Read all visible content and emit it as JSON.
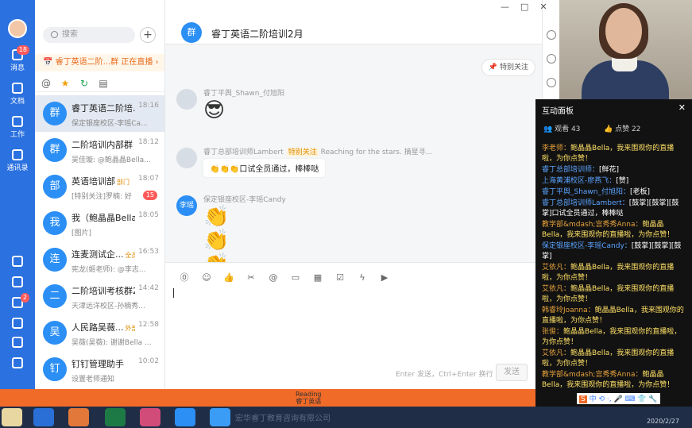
{
  "window": {
    "controls": [
      "—",
      "□",
      "✕"
    ]
  },
  "rail": {
    "items": [
      {
        "label": "消息",
        "icon": "message-icon",
        "badge": "18"
      },
      {
        "label": "文档",
        "icon": "document-icon"
      },
      {
        "label": "工作",
        "icon": "grid-icon"
      },
      {
        "label": "通讯录",
        "icon": "contacts-icon"
      }
    ],
    "lower_badge": "2"
  },
  "sidebar": {
    "search_placeholder": "搜索",
    "live_text": "睿丁英语二阶...群 正在直播",
    "conversations": [
      {
        "name": "睿丁英语二阶培...",
        "preview": "保定银座校区-李瑶Ca...",
        "time": "18:16",
        "avatar": "群"
      },
      {
        "name": "二阶培训内部群",
        "preview": "吴佳璇: @鲍晶晶Bella...",
        "time": "18:12",
        "avatar": "群"
      },
      {
        "name": "英语培训部",
        "tag": "部门",
        "preview": "[特别关注]罗楠: 好",
        "time": "18:07",
        "count": "15",
        "avatar": "部"
      },
      {
        "name": "我（鲍晶晶Bella...",
        "preview": "[图片]",
        "time": "18:05",
        "avatar": "我"
      },
      {
        "name": "连麦测试企...",
        "tag": "全员",
        "preview": "宪龙(姬老师): @李志...",
        "time": "16:53",
        "avatar": "连"
      },
      {
        "name": "二阶培训考核群2",
        "preview": "天津远洋校区-孙楠秀...",
        "time": "14:42",
        "avatar": "二"
      },
      {
        "name": "人民路吴薇...",
        "tag": "外部",
        "preview": "吴薇(吴薇): 谢谢Bella ...",
        "time": "12:58",
        "avatar": "吴"
      },
      {
        "name": "钉钉管理助手",
        "preview": "设置老师通知",
        "time": "10:02",
        "avatar": "钉"
      }
    ]
  },
  "chat": {
    "title": "睿丁英语二阶培训2月",
    "follow_label": "特别关注",
    "messages": [
      {
        "sender": "睿丁平舆_Shawn_付旭阳",
        "content": "😎"
      },
      {
        "sender": "睿丁总部培训师Lambert",
        "tag": "特别关注",
        "signature": "Reaching for the stars. 摘星寻...",
        "content": "👏👏👏口试全员通过，棒棒哒"
      },
      {
        "sender": "保定银座校区-李瑶Candy",
        "avatar": "李瑶",
        "content": "👏👏👏"
      }
    ],
    "input_hint": "Enter 发送，Ctrl+Enter 换行",
    "send_label": "发送"
  },
  "panel": {
    "title": "互动面板",
    "viewers": "观看 43",
    "likes": "点赞 22",
    "feed": [
      {
        "user": "李老师：",
        "text": "鲍晶晶Bella，我来围观你的直播啦，为你点赞！",
        "style": "orange"
      },
      {
        "user": "睿丁总部培训师：",
        "text": "[鲜花]",
        "style": "blue"
      },
      {
        "user": "上海黄浦校区-廖燕飞：",
        "text": "[赞]",
        "style": "blue"
      },
      {
        "user": "睿丁平舆_Shawn_付旭阳：",
        "text": "[老板]",
        "style": "blue"
      },
      {
        "user": "睿丁总部培训师Lambert：",
        "text": "[鼓掌][鼓掌][鼓掌]口试全员通过，棒棒哒",
        "style": "blue"
      },
      {
        "user": "教学部&mdash;宫秀秀Anna：",
        "text": "鲍晶晶Bella，我来围观你的直播啦，为你点赞！",
        "style": "orange"
      },
      {
        "user": "保定银座校区-李瑶Candy：",
        "text": "[鼓掌][鼓掌][鼓掌]",
        "style": "blue"
      },
      {
        "user": "艾依凡：",
        "text": "鲍晶晶Bella，我来围观你的直播啦，为你点赞！",
        "style": "orange"
      },
      {
        "user": "艾依凡：",
        "text": "鲍晶晶Bella，我来围观你的直播啦，为你点赞！",
        "style": "orange"
      },
      {
        "user": "韩睿玲Joanna：",
        "text": "鲍晶晶Bella，我来围观你的直播啦，为你点赞！",
        "style": "orange"
      },
      {
        "user": "张俊：",
        "text": "鲍晶晶Bella，我来围观你的直播啦，为你点赞！",
        "style": "orange"
      },
      {
        "user": "艾依凡：",
        "text": "鲍晶晶Bella，我来围观你的直播啦，为你点赞！",
        "style": "orange"
      },
      {
        "user": "教学部&mdash;宫秀秀Anna：",
        "text": "鲍晶晶Bella，我来围观你的直播啦，为你点赞！",
        "style": "orange"
      }
    ],
    "ime": "中 ⟲ ·, 🎤 ⌨ 👕 🔧"
  },
  "banner": {
    "brand": "Reading",
    "sub": "睿丁英语"
  },
  "taskbar": {
    "text": "宏华睿丁教育咨询有限公司",
    "date": "2020/2/27"
  }
}
